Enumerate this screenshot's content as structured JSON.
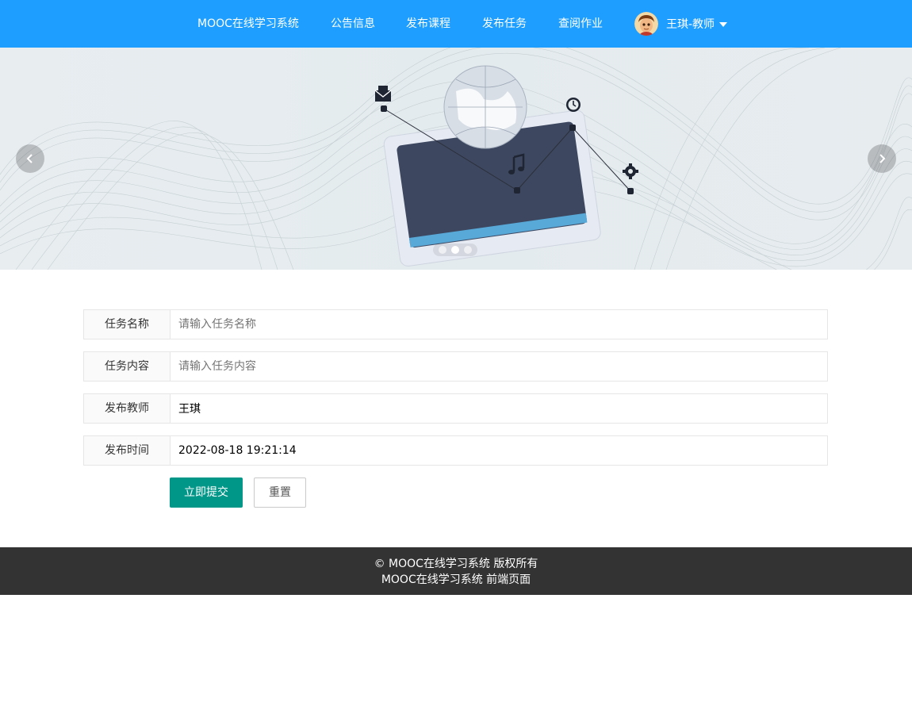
{
  "nav": {
    "brand": "MOOC在线学习系统",
    "items": [
      {
        "label": "公告信息"
      },
      {
        "label": "发布课程"
      },
      {
        "label": "发布任务"
      },
      {
        "label": "查阅作业"
      }
    ],
    "user_label": "王琪-教师"
  },
  "banner": {
    "slide_count": 3,
    "active_slide": 2
  },
  "form": {
    "task_name": {
      "label": "任务名称",
      "placeholder": "请输入任务名称",
      "value": ""
    },
    "task_content": {
      "label": "任务内容",
      "placeholder": "请输入任务内容",
      "value": ""
    },
    "teacher": {
      "label": "发布教师",
      "value": "王琪"
    },
    "publish_time": {
      "label": "发布时间",
      "value": "2022-08-18 19:21:14"
    },
    "submit_label": "立即提交",
    "reset_label": "重置"
  },
  "footer": {
    "line1": "© MOOC在线学习系统 版权所有",
    "line2": "MOOC在线学习系统 前端页面"
  },
  "colors": {
    "nav_bg": "#1e9fff",
    "primary_button": "#009688",
    "footer_bg": "#333333"
  }
}
